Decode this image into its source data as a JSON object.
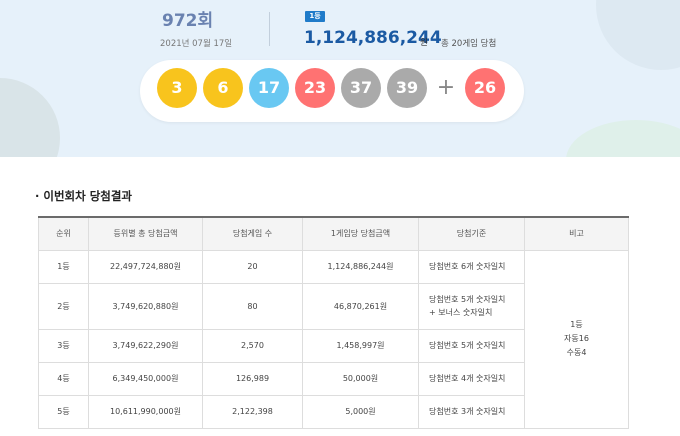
{
  "draw": {
    "round": "972회",
    "date": "2021년 07월 17일",
    "rank_badge": "1등",
    "first_prize": "1,124,886,244",
    "prize_unit": "원",
    "prize_note": "총 20게임 당첨"
  },
  "balls": [
    {
      "number": "3",
      "color": "#f8c41d"
    },
    {
      "number": "6",
      "color": "#f8c41d"
    },
    {
      "number": "17",
      "color": "#69c8f2"
    },
    {
      "number": "23",
      "color": "#ff7272"
    },
    {
      "number": "37",
      "color": "#aaaaaa"
    },
    {
      "number": "39",
      "color": "#aaaaaa"
    }
  ],
  "plus_symbol": "+",
  "bonus_ball": {
    "number": "26",
    "color": "#ff7272"
  },
  "results": {
    "title": "· 이번회차 당첨결과",
    "headers": [
      "순위",
      "등위별 총 당첨금액",
      "당첨게임 수",
      "1게임당 당첨금액",
      "당첨기준",
      "비고"
    ],
    "rows": [
      {
        "rank": "1등",
        "total": "22,497,724,880원",
        "games": "20",
        "per_game": "1,124,886,244원",
        "criteria": "당첨번호 6개 숫자일치"
      },
      {
        "rank": "2등",
        "total": "3,749,620,880원",
        "games": "80",
        "per_game": "46,870,261원",
        "criteria": "당첨번호 5개 숫자일치",
        "criteria2": "+ 보너스 숫자일치"
      },
      {
        "rank": "3등",
        "total": "3,749,622,290원",
        "games": "2,570",
        "per_game": "1,458,997원",
        "criteria": "당첨번호 5개 숫자일치"
      },
      {
        "rank": "4등",
        "total": "6,349,450,000원",
        "games": "126,989",
        "per_game": "50,000원",
        "criteria": "당첨번호 4개 숫자일치"
      },
      {
        "rank": "5등",
        "total": "10,611,990,000원",
        "games": "2,122,398",
        "per_game": "5,000원",
        "criteria": "당첨번호 3개 숫자일치"
      }
    ],
    "remark": [
      "1등",
      "자동16",
      "수동4"
    ]
  },
  "colors": {
    "accent": "#1b5aa3",
    "badge": "#1f7bc9",
    "hero_bg": "#e6f1fa"
  }
}
